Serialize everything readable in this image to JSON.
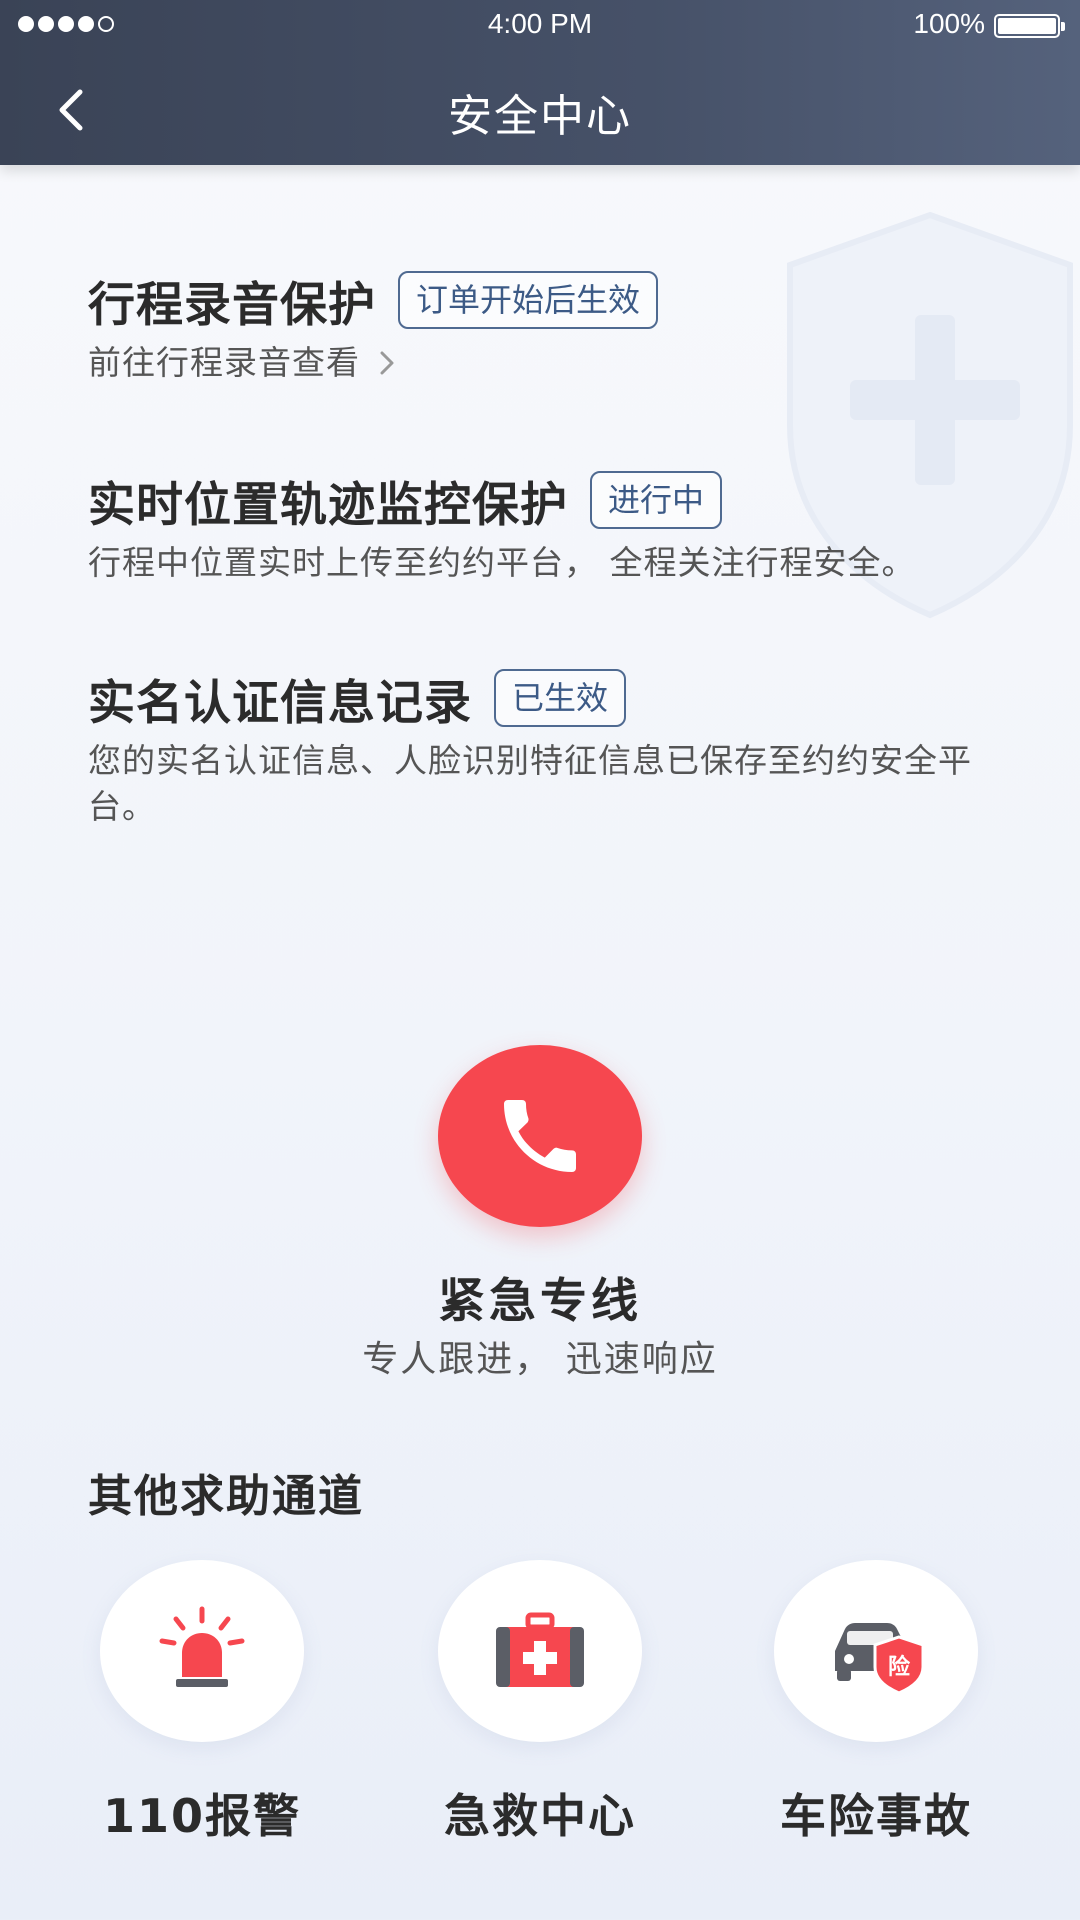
{
  "status_bar": {
    "time": "4:00 PM",
    "battery": "100%"
  },
  "header": {
    "title": "安全中心"
  },
  "features": [
    {
      "title": "行程录音保护",
      "tag": "订单开始后生效",
      "desc": "前往行程录音查看"
    },
    {
      "title": "实时位置轨迹监控保护",
      "tag": "进行中",
      "desc": "行程中位置实时上传至约约平台， 全程关注行程安全。"
    },
    {
      "title": "实名认证信息记录",
      "tag": "已生效",
      "desc": "您的实名认证信息、人脸识别特征信息已保存至约约安全平台。"
    }
  ],
  "emergency": {
    "title": "紧急专线",
    "subtitle": "专人跟进， 迅速响应"
  },
  "other_channels": {
    "heading": "其他求助通道",
    "items": [
      {
        "label": "110报警",
        "icon": "police-siren-icon"
      },
      {
        "label": "急救中心",
        "icon": "first-aid-kit-icon"
      },
      {
        "label": "车险事故",
        "icon": "car-insurance-icon",
        "badge": "险"
      }
    ]
  },
  "colors": {
    "header_bg": "#3a4356",
    "accent_red": "#f6474f",
    "tag_border": "#4f6a91",
    "car_gray": "#5b5e66"
  }
}
